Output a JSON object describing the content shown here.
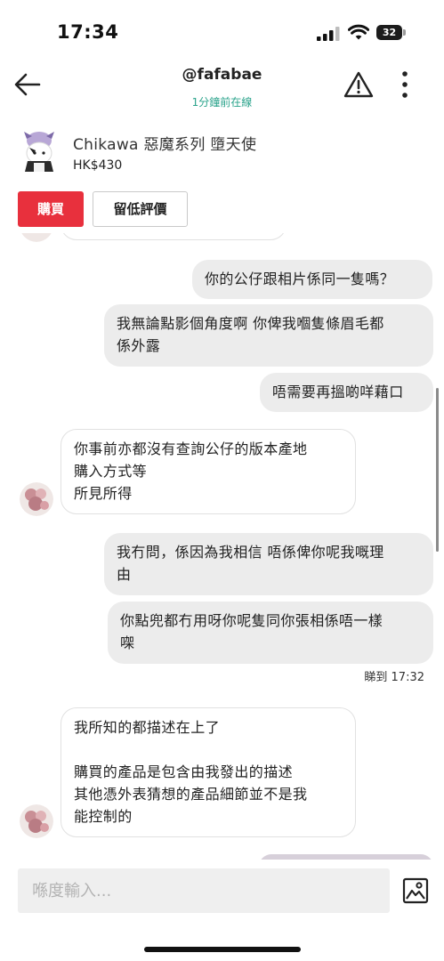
{
  "status_bar": {
    "time": "17:34",
    "battery": "32",
    "icons": [
      "signal-icon",
      "wifi-icon",
      "battery-icon"
    ]
  },
  "header": {
    "username": "@fafabae",
    "status": "1分鐘前在線",
    "icons": [
      "back-arrow-icon",
      "warning-icon",
      "more-vertical-icon"
    ],
    "status_color": "#2aa38b"
  },
  "product": {
    "name": "Chikawa 惡魔系列 墮天使",
    "price": "HK$430",
    "buy_label": "購買",
    "offer_label": "留低評價",
    "buy_color": "#e8303d"
  },
  "messages": [
    {
      "direction": "outgoing",
      "text": "你的公仔跟相片係同一隻嗎？"
    },
    {
      "direction": "outgoing",
      "text": "我無論點影個角度啊 你俾我嗰隻條眉毛都\n係外露"
    },
    {
      "direction": "outgoing",
      "text": "唔需要再搵啲咩藉口"
    },
    {
      "direction": "incoming",
      "text": "你事前亦都沒有查詢公仔的版本產地\n購入方式等\n所見所得"
    },
    {
      "direction": "outgoing",
      "text": "我冇問，係因為我相信 唔係俾你呢我嘅理\n由"
    },
    {
      "direction": "outgoing",
      "text": "你點兜都冇用呀你呢隻同你張相係唔一樣\n㗎"
    },
    {
      "direction": "incoming",
      "text": "我所知的都描述在上了\n\n購買的產品是包含由我發出的描述\n其他憑外表猜想的產品細節並不是我\n能控制的"
    }
  ],
  "read_receipt": "睇到 17:32",
  "input": {
    "placeholder": "喺度輸入...",
    "value": ""
  }
}
